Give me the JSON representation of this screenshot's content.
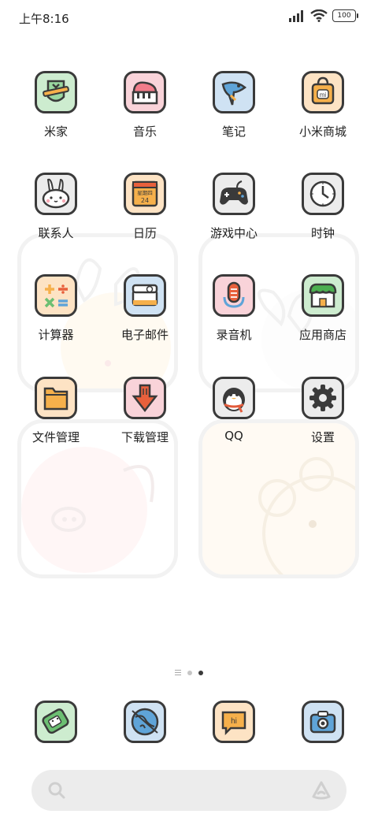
{
  "status_bar": {
    "time": "上午8:16",
    "battery": "100"
  },
  "grid": [
    {
      "label": "米家",
      "icon": "mijia-icon",
      "bg": "#cdeccf"
    },
    {
      "label": "音乐",
      "icon": "music-piano-icon",
      "bg": "#f9d3d9"
    },
    {
      "label": "笔记",
      "icon": "notes-bird-icon",
      "bg": "#cfe2f3"
    },
    {
      "label": "小米商城",
      "icon": "shopping-bag-icon",
      "bg": "#fde3c4"
    },
    {
      "label": "联系人",
      "icon": "contacts-bunny-icon",
      "bg": "#ececec"
    },
    {
      "label": "日历",
      "icon": "calendar-icon",
      "bg": "#fde3c4",
      "cal_text": "星期四",
      "cal_day": "24"
    },
    {
      "label": "游戏中心",
      "icon": "gamepad-icon",
      "bg": "#ececec"
    },
    {
      "label": "时钟",
      "icon": "clock-icon",
      "bg": "#ececec"
    },
    {
      "label": "计算器",
      "icon": "calculator-icon",
      "bg": "#fde3c4"
    },
    {
      "label": "电子邮件",
      "icon": "email-icon",
      "bg": "#cfe2f3"
    },
    {
      "label": "录音机",
      "icon": "recorder-icon",
      "bg": "#f9d3d9"
    },
    {
      "label": "应用商店",
      "icon": "app-store-icon",
      "bg": "#cdeccf"
    },
    {
      "label": "文件管理",
      "icon": "folder-icon",
      "bg": "#fde3c4"
    },
    {
      "label": "下载管理",
      "icon": "download-icon",
      "bg": "#f9d3d9"
    },
    {
      "label": "QQ",
      "icon": "qq-penguin-icon",
      "bg": "#ececec"
    },
    {
      "label": "设置",
      "icon": "settings-gear-icon",
      "bg": "#ececec"
    }
  ],
  "dock": [
    {
      "icon": "phone-icon",
      "bg": "#cdeccf"
    },
    {
      "icon": "browser-globe-icon",
      "bg": "#cfe2f3"
    },
    {
      "icon": "messages-hi-icon",
      "bg": "#fde3c4",
      "text": "hi"
    },
    {
      "icon": "camera-icon",
      "bg": "#cfe2f3"
    }
  ],
  "page_indicator": {
    "pages": 2,
    "active": 2
  },
  "search": {
    "placeholder": ""
  },
  "colors": {
    "outline": "#3a3a3a",
    "widget_border": "#f2f2f2",
    "search_bg": "#ececec",
    "calendar_red": "#e8603c",
    "qq_scarf": "#e25b3b"
  }
}
